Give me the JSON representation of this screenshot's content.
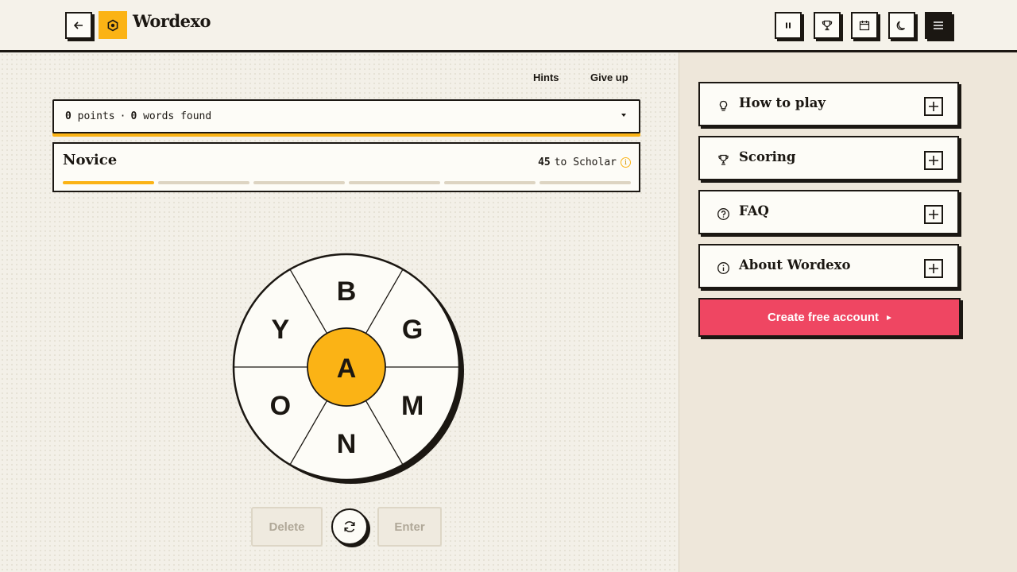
{
  "header": {
    "brand": "Wordexo",
    "icons": {
      "back": "arrow-left-icon",
      "logo": "hexagon-logo-icon",
      "pause": "pause-icon",
      "trophy": "trophy-icon",
      "calendar": "calendar-icon",
      "theme": "moon-icon",
      "menu": "hamburger-menu-icon"
    }
  },
  "game": {
    "hints_label": "Hints",
    "give_up_label": "Give up",
    "score": {
      "points": "0",
      "points_label": "points",
      "separator": "·",
      "words": "0",
      "words_label": "words found"
    },
    "rank": {
      "name": "Novice",
      "to_next": "45",
      "next_label": "to Scholar",
      "info_glyph": "i",
      "segments": 6,
      "filled": 1
    },
    "letters": {
      "center": "A",
      "outer": [
        "B",
        "G",
        "M",
        "N",
        "O",
        "Y"
      ]
    },
    "buttons": {
      "delete": "Delete",
      "enter": "Enter",
      "shuffle_icon": "shuffle-icon"
    }
  },
  "sidebar": {
    "items": [
      {
        "label": "How to play",
        "icon": "lightbulb-icon"
      },
      {
        "label": "Scoring",
        "icon": "trophy-icon"
      },
      {
        "label": "FAQ",
        "icon": "question-circle-icon"
      },
      {
        "label": "About Wordexo",
        "icon": "info-circle-icon"
      }
    ],
    "cta_label": "Create free account"
  },
  "colors": {
    "accent": "#fbb315",
    "cta": "#ef4662",
    "ink": "#1b1712",
    "paper": "#fdfcf7"
  }
}
